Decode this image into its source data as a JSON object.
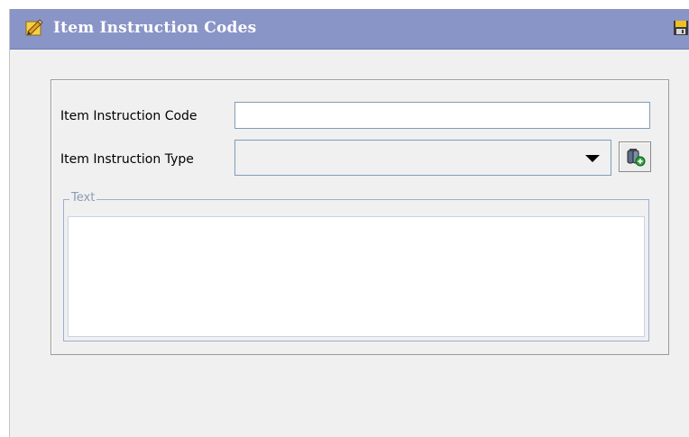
{
  "window": {
    "title": "Item Instruction Codes",
    "title_icon": "edit-pencil-icon",
    "save_icon": "save-floppy-icon",
    "titlebar_color": "#8a95c7"
  },
  "form": {
    "code_label": "Item Instruction Code",
    "code_value": "",
    "type_label": "Item Instruction Type",
    "type_value": "",
    "lookup_icon": "lookup-add-icon",
    "text_legend": "Text",
    "text_value": ""
  }
}
